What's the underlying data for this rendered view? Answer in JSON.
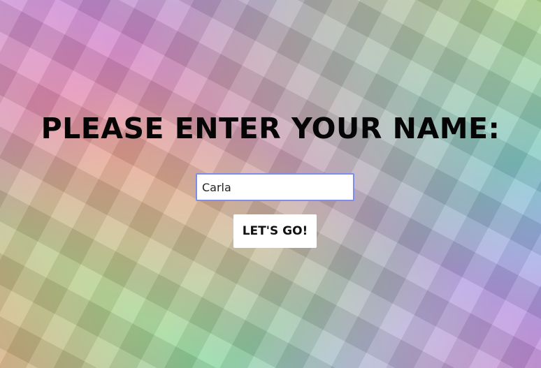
{
  "heading": "PLEASE ENTER YOUR NAME:",
  "name_input": {
    "value": "Carla",
    "placeholder": ""
  },
  "go_button_label": "LET'S GO!",
  "colors": {
    "heading": "#050505",
    "input_border": "#7b8fe8",
    "button_bg": "#ffffff"
  }
}
